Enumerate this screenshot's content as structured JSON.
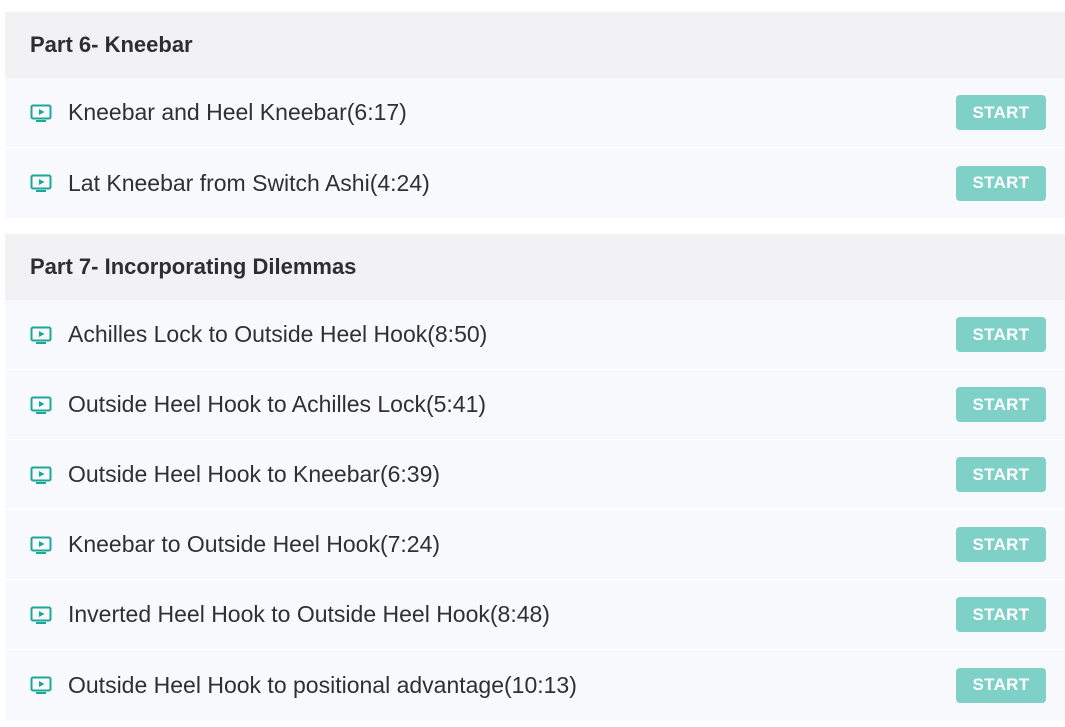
{
  "colors": {
    "header_bg": "#f2f2f5",
    "row_bg": "#f8f9fc",
    "accent": "#1aa89a",
    "button_bg": "#7fd1c8",
    "button_text": "#ffffff"
  },
  "icons": {
    "lecture": "play-video-icon"
  },
  "sections": [
    {
      "title": "Part 6- Kneebar",
      "lectures": [
        {
          "title": "Kneebar and Heel Kneebar(6:17)",
          "button": "START"
        },
        {
          "title": "Lat Kneebar from Switch Ashi(4:24)",
          "button": "START"
        }
      ]
    },
    {
      "title": "Part 7- Incorporating Dilemmas",
      "lectures": [
        {
          "title": "Achilles Lock to Outside Heel Hook(8:50)",
          "button": "START"
        },
        {
          "title": "Outside Heel Hook to Achilles Lock(5:41)",
          "button": "START"
        },
        {
          "title": "Outside Heel Hook to Kneebar(6:39)",
          "button": "START"
        },
        {
          "title": "Kneebar to Outside Heel Hook(7:24)",
          "button": "START"
        },
        {
          "title": "Inverted Heel Hook to Outside Heel Hook(8:48)",
          "button": "START"
        },
        {
          "title": "Outside Heel Hook to positional advantage(10:13)",
          "button": "START"
        }
      ]
    }
  ]
}
